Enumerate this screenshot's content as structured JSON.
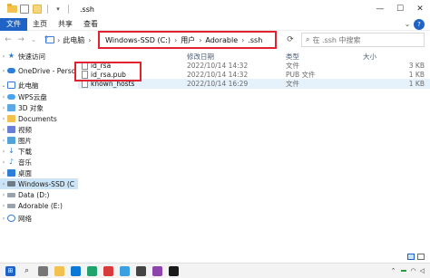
{
  "window": {
    "title": ".ssh"
  },
  "ribbon": {
    "tabs": [
      "文件",
      "主页",
      "共享",
      "查看"
    ]
  },
  "address": {
    "left_label": "此电脑",
    "crumbs": [
      "Windows-SSD (C:)",
      "用户",
      "Adorable",
      ".ssh"
    ],
    "search_placeholder": "在 .ssh 中搜索"
  },
  "columns": {
    "date": "修改日期",
    "type": "类型",
    "size": "大小"
  },
  "sidebar": {
    "items": [
      {
        "label": "快速访问",
        "icon": "star-icon"
      },
      {
        "label": "OneDrive - Perso",
        "icon": "cloud-icon"
      },
      {
        "label": "此电脑",
        "icon": "pc-icon"
      },
      {
        "label": "WPS云盘",
        "icon": "cloud-icon"
      },
      {
        "label": "3D 对象",
        "icon": "cube-icon"
      },
      {
        "label": "Documents",
        "icon": "folder-icon"
      },
      {
        "label": "视频",
        "icon": "video-icon"
      },
      {
        "label": "图片",
        "icon": "image-icon"
      },
      {
        "label": "下载",
        "icon": "download-icon"
      },
      {
        "label": "音乐",
        "icon": "music-icon"
      },
      {
        "label": "桌面",
        "icon": "desktop-icon"
      },
      {
        "label": "Windows-SSD (C",
        "icon": "drive-icon"
      },
      {
        "label": "Data (D:)",
        "icon": "drive-icon"
      },
      {
        "label": "Adorable (E:)",
        "icon": "drive-icon"
      },
      {
        "label": "网络",
        "icon": "network-icon"
      }
    ]
  },
  "files": [
    {
      "name": "id_rsa",
      "date": "2022/10/14 14:32",
      "type": "文件",
      "size": "3 KB"
    },
    {
      "name": "id_rsa.pub",
      "date": "2022/10/14 14:32",
      "type": "PUB 文件",
      "size": "1 KB"
    },
    {
      "name": "known_hosts",
      "date": "2022/10/14 16:29",
      "type": "文件",
      "size": "1 KB"
    }
  ],
  "colors": {
    "accent": "#1f63c6",
    "highlight_red": "#e0232e",
    "selected": "#cce4f7"
  }
}
